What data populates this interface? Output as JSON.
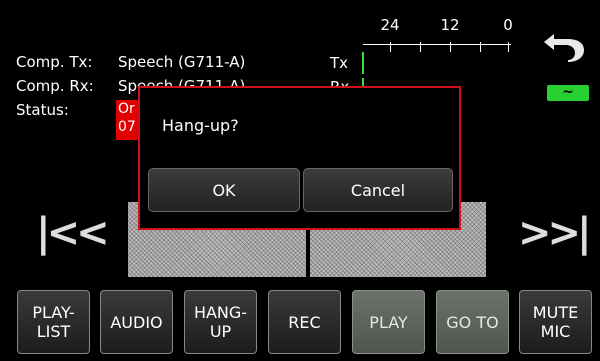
{
  "info": {
    "comp_tx_label": "Comp. Tx:",
    "comp_tx_value": "Speech (G711-A)",
    "comp_rx_label": "Comp. Rx:",
    "comp_rx_value": "Speech (G711-A)",
    "status_label": "Status:",
    "status_value": "Or\n07"
  },
  "meter": {
    "scale_labels": [
      "24",
      "12",
      "0"
    ],
    "tx_label": "Tx",
    "rx_label": "Rx"
  },
  "colors": {
    "alert_red": "#d0101a",
    "level_green": "#39e03c",
    "active_green": "#27d030"
  },
  "icons": {
    "back": "undo-arrow-icon",
    "active": "tilde-status-icon",
    "prev": "skip-back-icon",
    "next": "skip-forward-icon"
  },
  "active_badge": "~",
  "nav": {
    "prev": "|<<",
    "next": ">>|"
  },
  "dialog": {
    "title": "Hang-up?",
    "ok_label": "OK",
    "cancel_label": "Cancel"
  },
  "toolbar": {
    "playlist": "PLAY-\nLIST",
    "audio": "AUDIO",
    "hangup": "HANG-\nUP",
    "rec": "REC",
    "play": "PLAY",
    "goto": "GO TO",
    "mute": "MUTE\nMIC"
  }
}
